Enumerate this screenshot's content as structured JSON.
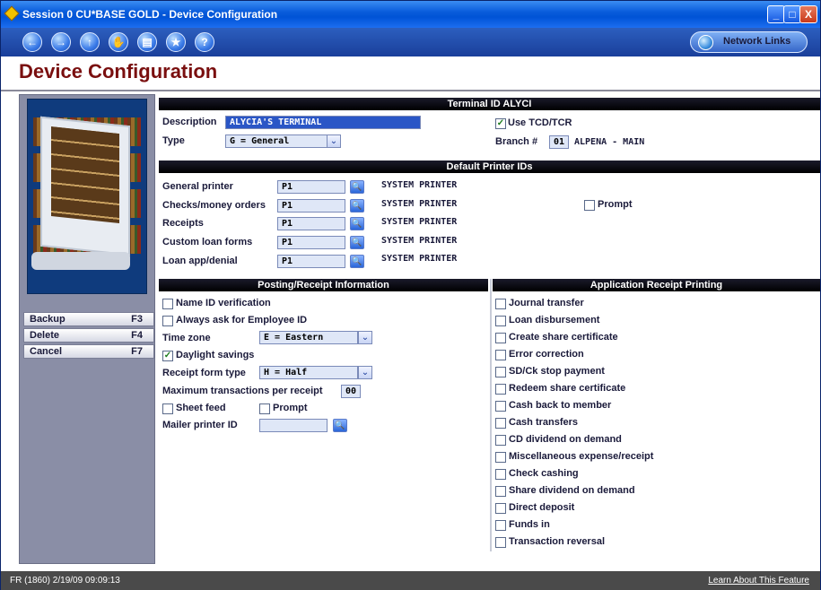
{
  "window": {
    "title": "Session 0 CU*BASE GOLD - Device Configuration",
    "controls": [
      "_",
      "□",
      "X"
    ]
  },
  "toolbar": {
    "nav_icons": [
      "back-icon",
      "forward-icon",
      "up-icon",
      "hand-icon",
      "print-icon",
      "favorites-icon",
      "help-icon"
    ],
    "network_links": "Network Links"
  },
  "page": {
    "title": "Device Configuration"
  },
  "fkeys": [
    {
      "label": "Backup",
      "key": "F3"
    },
    {
      "label": "Delete",
      "key": "F4"
    },
    {
      "label": "Cancel",
      "key": "F7"
    }
  ],
  "terminal": {
    "header": "Terminal ID ALYCI",
    "description_label": "Description",
    "description_value": "ALYCIA'S TERMINAL",
    "type_label": "Type",
    "type_value": "G = General",
    "use_tcd_label": "Use TCD/TCR",
    "use_tcd_checked": true,
    "branch_label": "Branch #",
    "branch_value": "01",
    "branch_name": "ALPENA - MAIN"
  },
  "printers": {
    "header": "Default Printer IDs",
    "rows": [
      {
        "label": "General printer",
        "value": "P1",
        "desc": "SYSTEM PRINTER"
      },
      {
        "label": "Checks/money orders",
        "value": "P1",
        "desc": "SYSTEM PRINTER"
      },
      {
        "label": "Receipts",
        "value": "P1",
        "desc": "SYSTEM PRINTER"
      },
      {
        "label": "Custom loan forms",
        "value": "P1",
        "desc": "SYSTEM PRINTER"
      },
      {
        "label": "Loan app/denial",
        "value": "P1",
        "desc": "SYSTEM PRINTER"
      }
    ],
    "prompt_label": "Prompt"
  },
  "posting": {
    "header": "Posting/Receipt Information",
    "name_id_label": "Name ID verification",
    "always_ask_label": "Always ask for Employee ID",
    "time_zone_label": "Time zone",
    "time_zone_value": "E = Eastern",
    "daylight_label": "Daylight savings",
    "receipt_form_label": "Receipt form type",
    "receipt_form_value": "H = Half",
    "max_trans_label": "Maximum transactions per receipt",
    "max_trans_value": "00",
    "sheet_feed_label": "Sheet feed",
    "prompt_label": "Prompt",
    "mailer_label": "Mailer printer ID",
    "mailer_value": ""
  },
  "app_receipt": {
    "header": "Application Receipt Printing",
    "items": [
      "Journal transfer",
      "Loan disbursement",
      "Create share certificate",
      "Error correction",
      "SD/Ck stop payment",
      "Redeem share certificate",
      "Cash back to member",
      "Cash transfers",
      "CD dividend on demand",
      "Miscellaneous expense/receipt",
      "Check cashing",
      "Share dividend on demand",
      "Direct deposit",
      "Funds in",
      "Transaction reversal"
    ]
  },
  "status": {
    "left": "FR (1860) 2/19/09 09:09:13",
    "right": "Learn About This Feature"
  }
}
